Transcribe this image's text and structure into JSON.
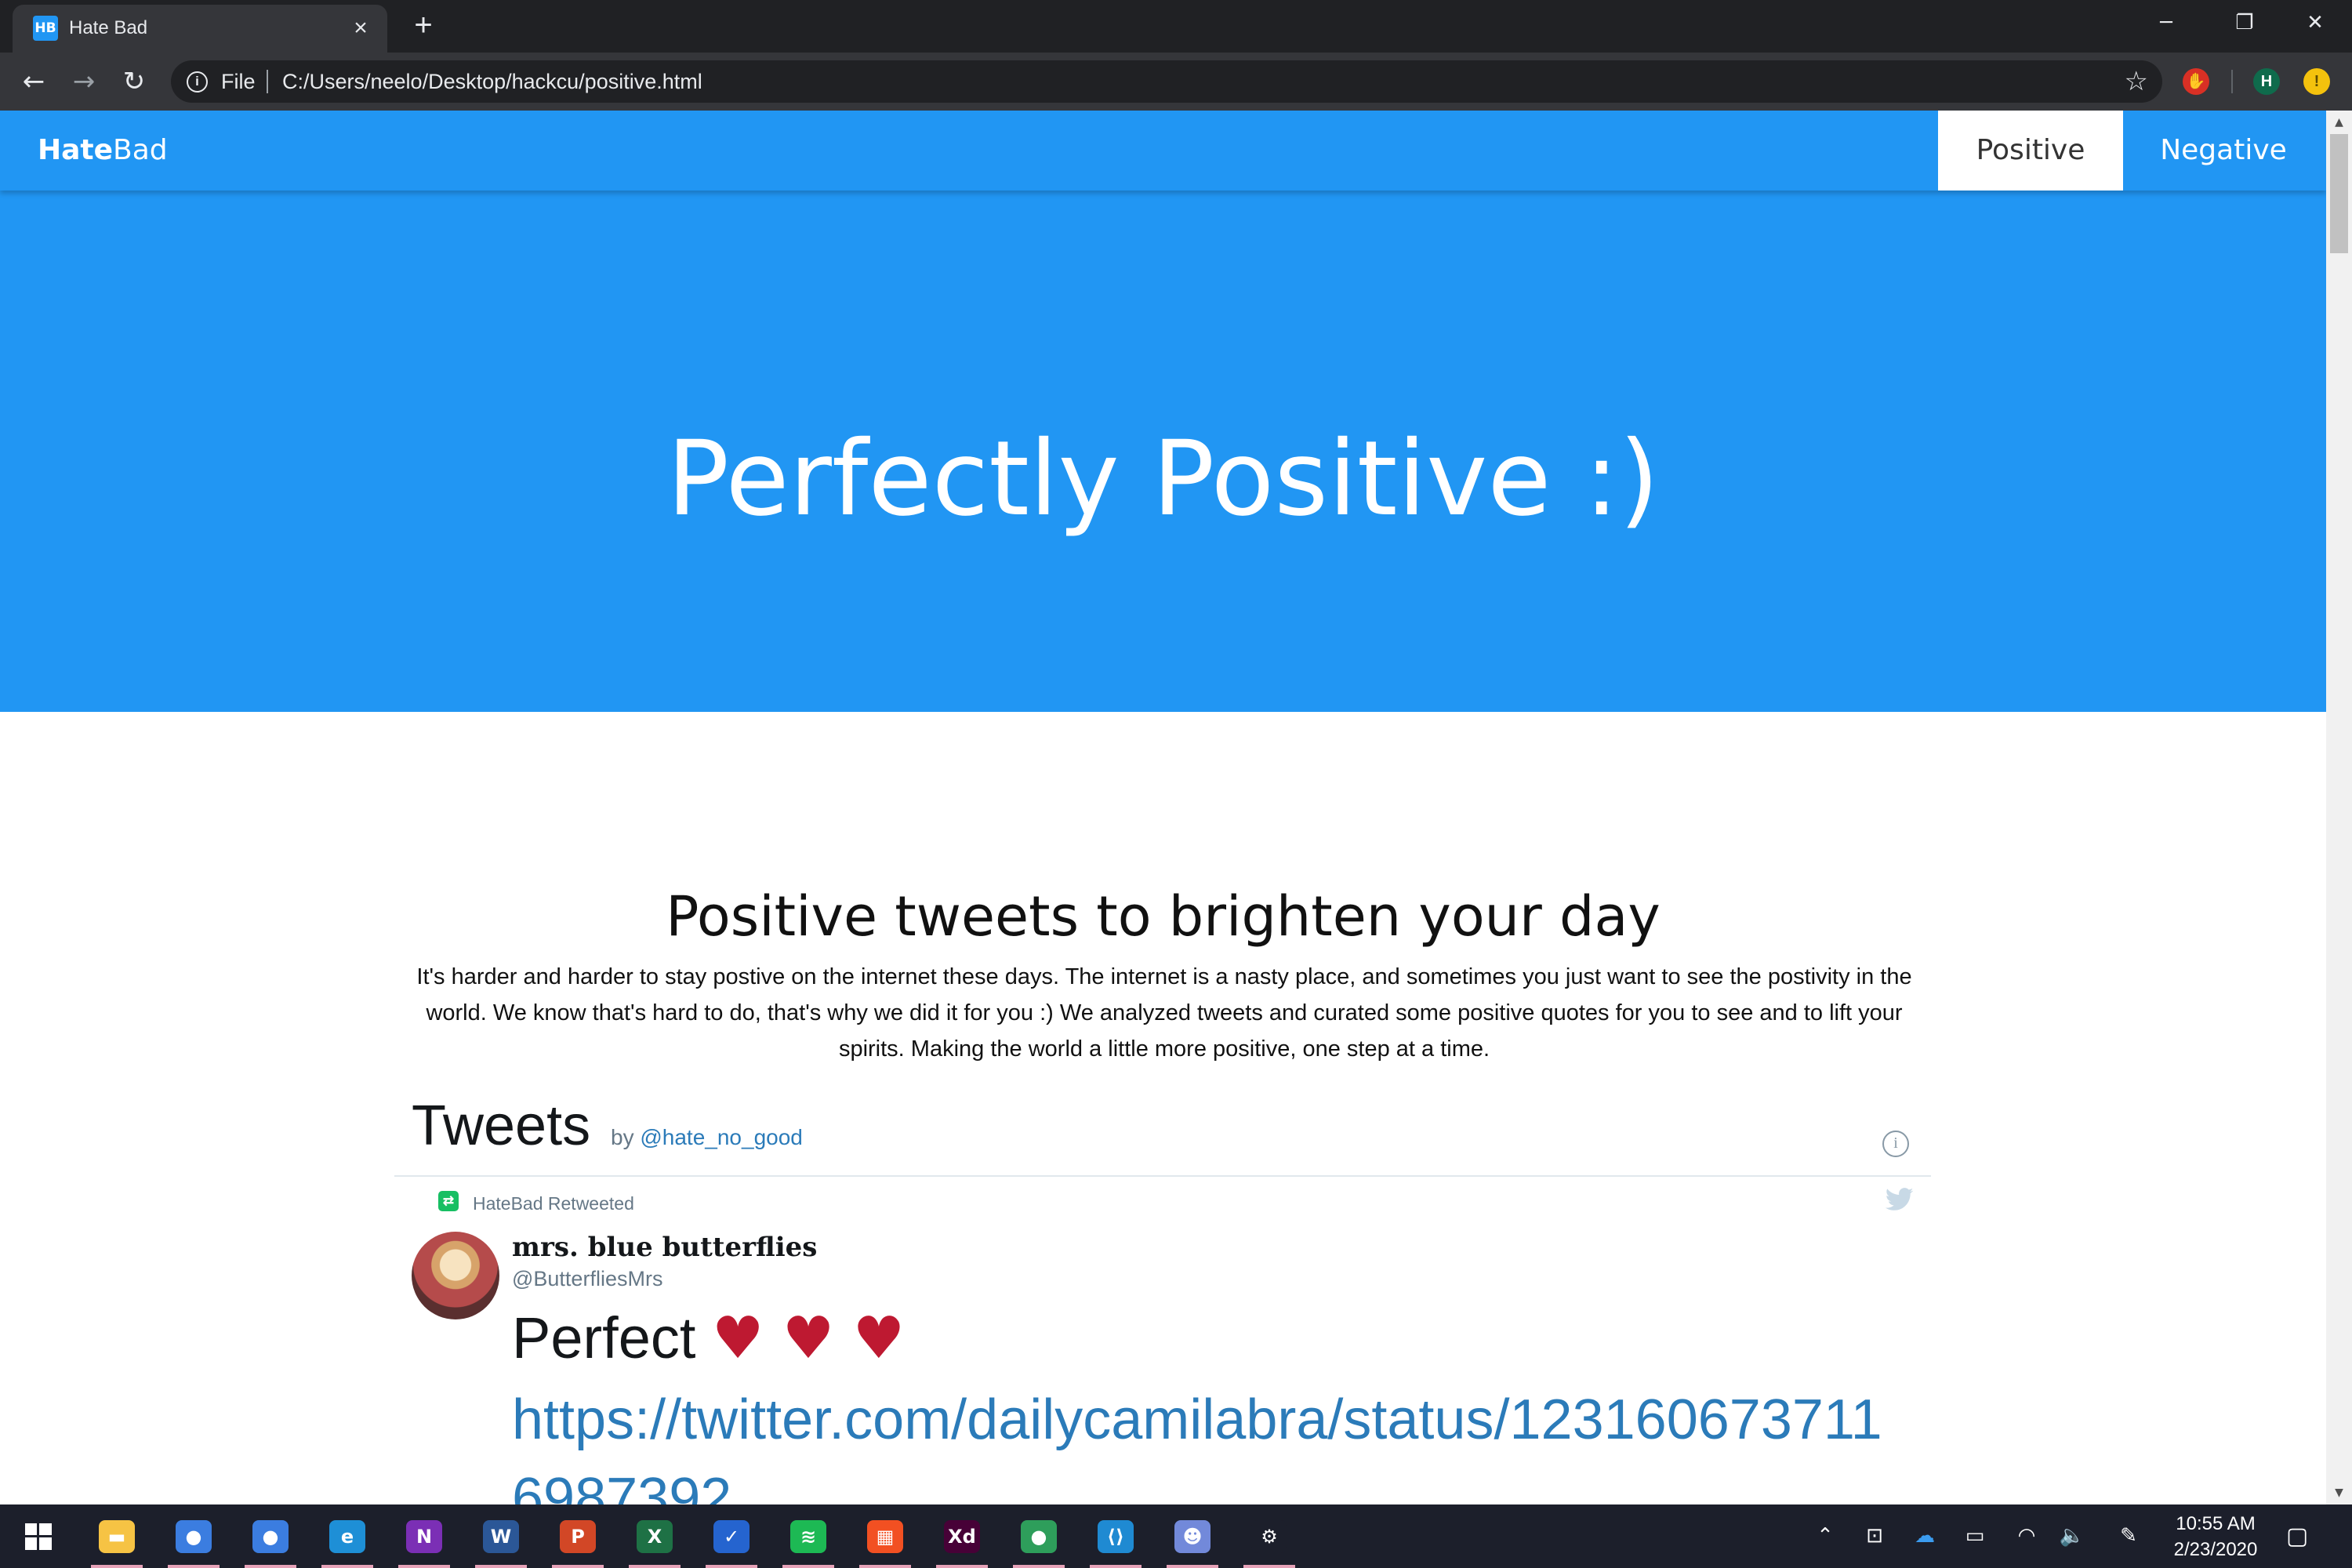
{
  "browser": {
    "tab_title": "Hate Bad",
    "favicon_text": "HB",
    "omnibox_label": "File",
    "url": "C:/Users/neelo/Desktop/hackcu/positive.html",
    "profile_initial": "H"
  },
  "navbar": {
    "brand_part1": "Hate",
    "brand_part2": "Bad",
    "links": [
      {
        "label": "Positive",
        "active": true
      },
      {
        "label": "Negative",
        "active": false
      }
    ],
    "color": "#2196f3"
  },
  "hero": {
    "title": "Perfectly Positive :)"
  },
  "intro": {
    "heading": "Positive tweets to brighten your day",
    "paragraph": "It's harder and harder to stay postive on the internet these days. The internet is a nasty place, and sometimes you just want to see the postivity in the world. We know that's hard to do, that's why we did it for you :) We analyzed tweets and curated some positive quotes for you to see and to lift your spirits. Making the world a little more positive, one step at a time."
  },
  "timeline": {
    "title": "Tweets",
    "by_prefix": "by",
    "handle": "@hate_no_good",
    "tweet": {
      "retweet_label": "HateBad Retweeted",
      "display_name": "mrs. blue butterflies",
      "username": "@ButterfliesMrs",
      "text": "Perfect",
      "hearts": "♥ ♥ ♥",
      "link": "https://twitter.com/dailycamilabra/status/1231606737116987392"
    }
  },
  "taskbar": {
    "apps": [
      {
        "name": "file-explorer",
        "glyph": "▬",
        "color": "#f6c344"
      },
      {
        "name": "chrome",
        "glyph": "●",
        "color": "#3b7de0"
      },
      {
        "name": "chrome-profile",
        "glyph": "●",
        "color": "#3b7de0"
      },
      {
        "name": "edge",
        "glyph": "e",
        "color": "#1e8fd6"
      },
      {
        "name": "onenote",
        "glyph": "N",
        "color": "#7b2fb5"
      },
      {
        "name": "word",
        "glyph": "W",
        "color": "#2b5797"
      },
      {
        "name": "powerpoint",
        "glyph": "P",
        "color": "#d24726"
      },
      {
        "name": "excel",
        "glyph": "X",
        "color": "#1e7145"
      },
      {
        "name": "todo",
        "glyph": "✓",
        "color": "#2564cf"
      },
      {
        "name": "spotify",
        "glyph": "≋",
        "color": "#1db954"
      },
      {
        "name": "store",
        "glyph": "▦",
        "color": "#f25022"
      },
      {
        "name": "adobe-xd",
        "glyph": "Xd",
        "color": "#470137"
      },
      {
        "name": "chrome-hatebad",
        "glyph": "●",
        "color": "#2e9e5b"
      },
      {
        "name": "vscode",
        "glyph": "⟨⟩",
        "color": "#1f8ad2"
      },
      {
        "name": "discord",
        "glyph": "☻",
        "color": "#7289da"
      },
      {
        "name": "settings",
        "glyph": "⚙",
        "color": "#1c1f2b"
      }
    ],
    "time": "10:55 AM",
    "date": "2/23/2020"
  }
}
